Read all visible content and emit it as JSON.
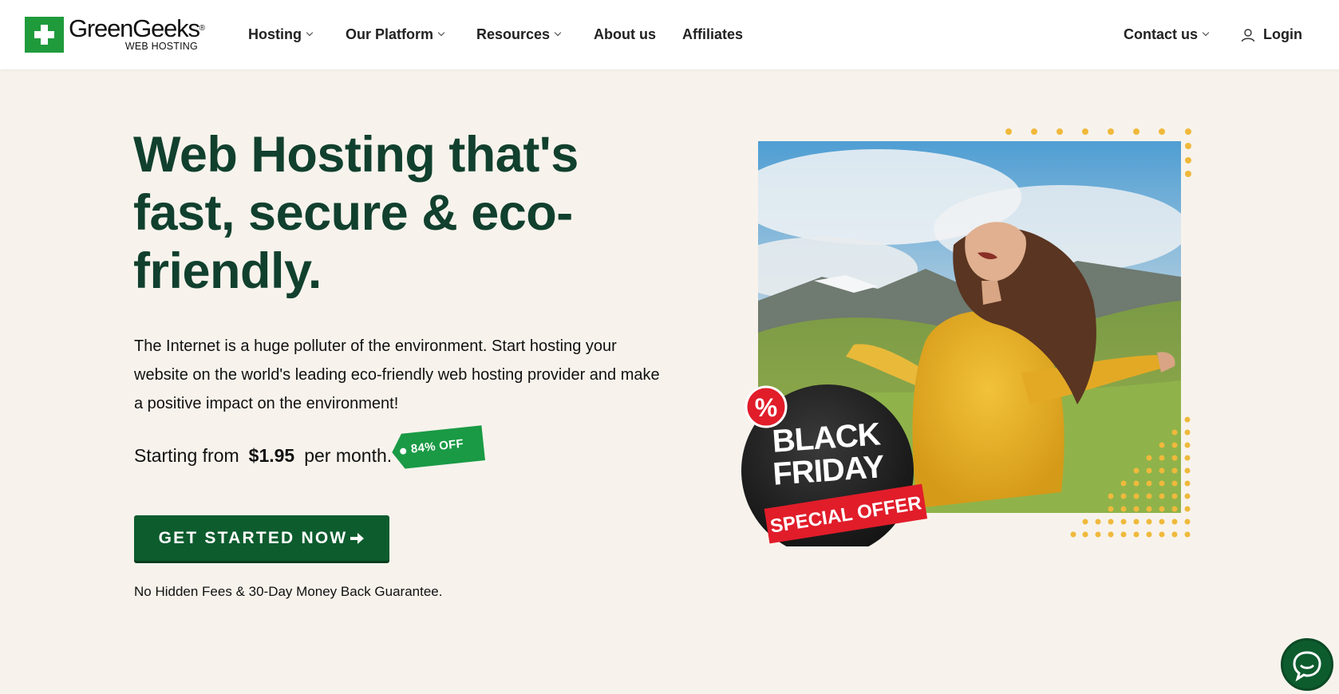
{
  "brand": {
    "name": "GreenGeeks",
    "reg": "®",
    "subtitle": "WEB HOSTING",
    "color": "#1f9b3c"
  },
  "nav": {
    "items": [
      {
        "label": "Hosting",
        "dropdown": true
      },
      {
        "label": "Our Platform",
        "dropdown": true
      },
      {
        "label": "Resources",
        "dropdown": true
      },
      {
        "label": "About us",
        "dropdown": false
      },
      {
        "label": "Affiliates",
        "dropdown": false
      }
    ],
    "contact": {
      "label": "Contact us",
      "dropdown": true
    },
    "login": {
      "label": "Login",
      "icon": "user-icon"
    }
  },
  "hero": {
    "title": "Web Hosting that's fast, secure & eco-friendly.",
    "description": "The Internet is a huge polluter of the environment. Start hosting your website on the world's leading eco-friendly web hosting provider and make a positive impact on the environment!",
    "price_prefix": "Starting from",
    "price": "$1.95",
    "price_suffix": "per month.",
    "discount_tag": "84% OFF",
    "cta_label": "GET STARTED NOW",
    "cta_icon": "arrow-right-icon",
    "guarantee": "No Hidden Fees & 30-Day Money Back Guarantee."
  },
  "promo": {
    "badge_symbol": "%",
    "line1": "BLACK",
    "line2": "FRIDAY",
    "ribbon": "SPECIAL OFFER"
  },
  "colors": {
    "title_green": "#11402e",
    "cta_green": "#0d5c2e",
    "tag_green": "#1a9a45",
    "background": "#f7f3ec",
    "dots": "#f0b93c",
    "badge_red": "#e11d2a"
  },
  "chat": {
    "icon": "chat-icon"
  }
}
